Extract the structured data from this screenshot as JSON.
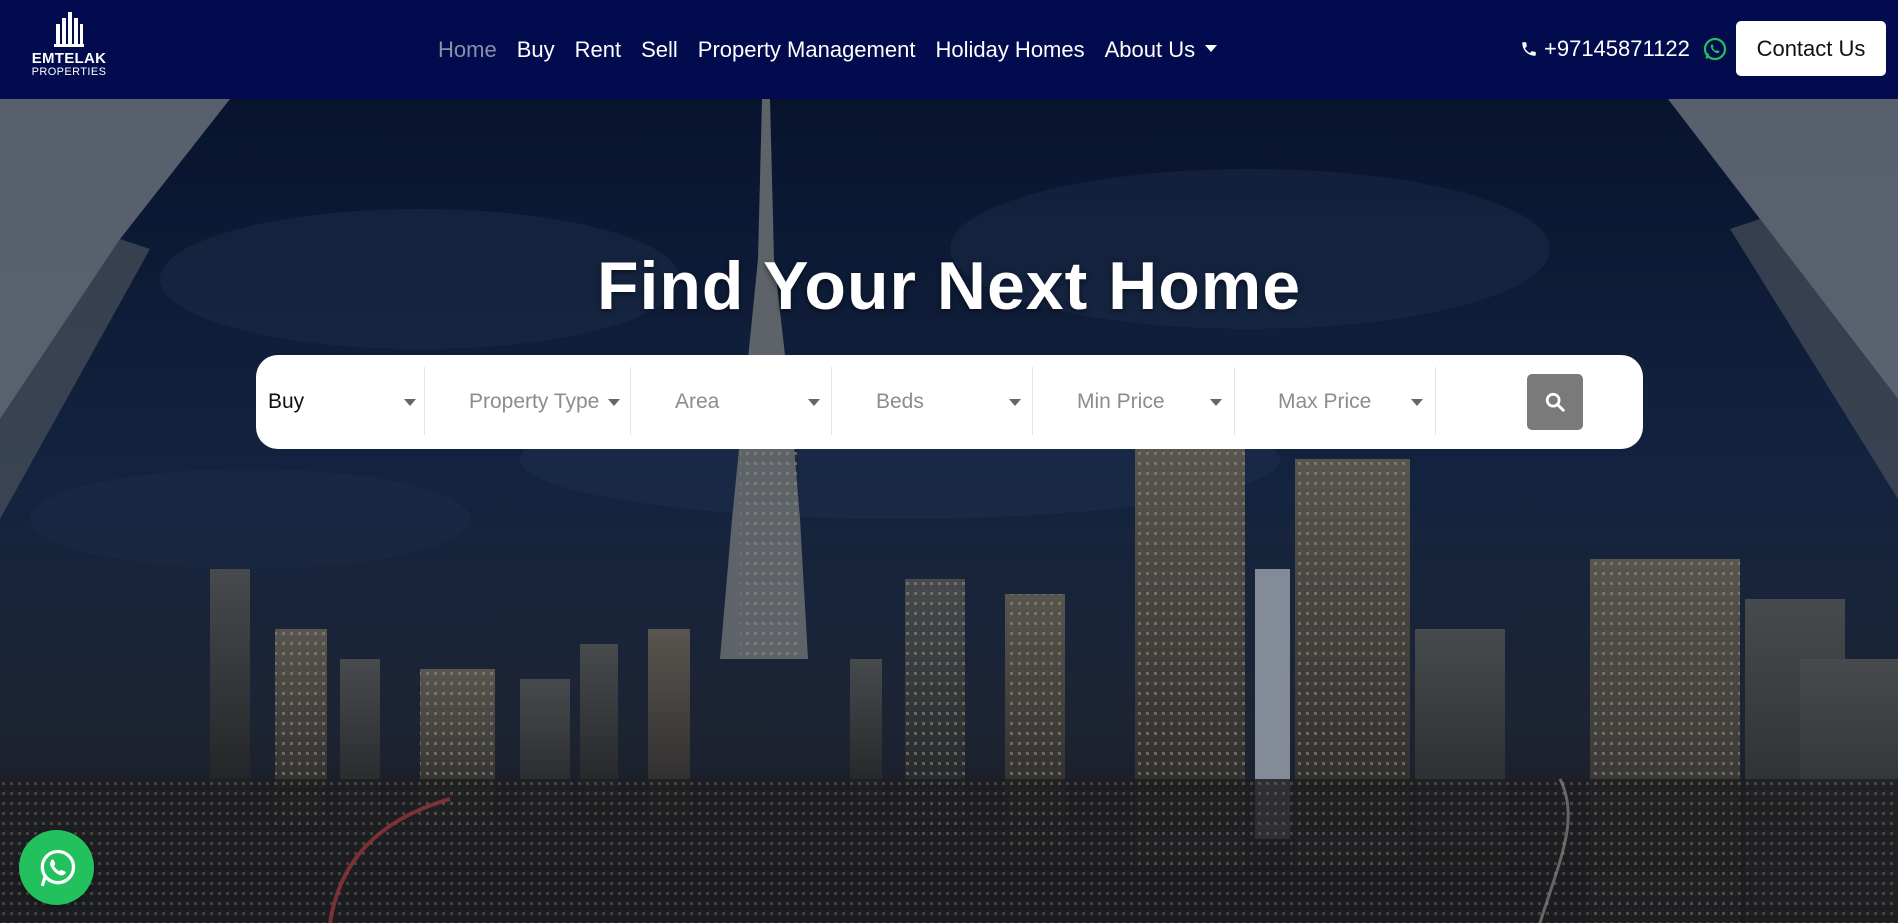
{
  "brand": {
    "name": "EMTELAK",
    "sub": "PROPERTIES"
  },
  "nav": {
    "items": [
      {
        "label": "Home",
        "active": true
      },
      {
        "label": "Buy"
      },
      {
        "label": "Rent"
      },
      {
        "label": "Sell"
      },
      {
        "label": "Property Management"
      },
      {
        "label": "Holiday Homes"
      },
      {
        "label": "About Us"
      }
    ],
    "phone": "+97145871122",
    "contact_label": "Contact Us"
  },
  "hero": {
    "title": "Find Your Next Home"
  },
  "search": {
    "purpose": "Buy",
    "property_type": "Property Type",
    "area": "Area",
    "beds": "Beds",
    "min_price": "Min Price",
    "max_price": "Max Price"
  },
  "colors": {
    "navbar": "#020b4d",
    "whatsapp": "#22c15e",
    "search_button": "#7a7a7a"
  },
  "icons": [
    "phone-icon",
    "whatsapp-icon",
    "search-icon",
    "caret-down-icon"
  ]
}
